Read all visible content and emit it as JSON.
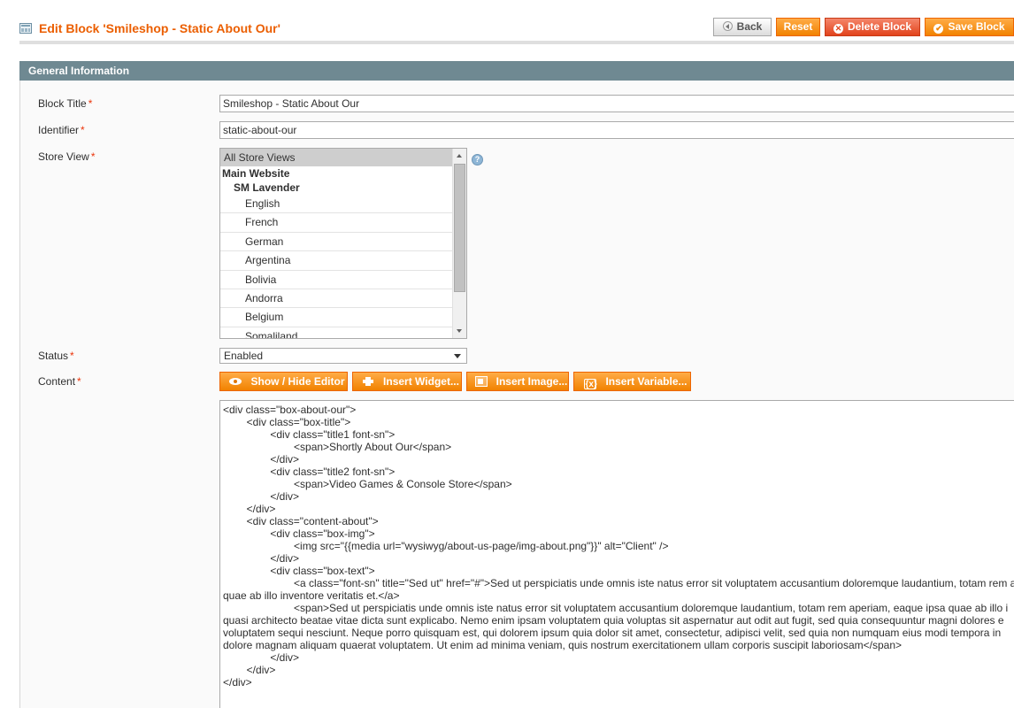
{
  "header": {
    "title": "Edit Block 'Smileshop - Static About Our'",
    "icon": "grid-icon",
    "buttons": {
      "back": "Back",
      "reset": "Reset",
      "delete": "Delete Block",
      "save": "Save Block"
    }
  },
  "fieldset": {
    "legend": "General Information"
  },
  "form": {
    "block_title": {
      "label": "Block Title",
      "required": "*",
      "value": "Smileshop - Static About Our"
    },
    "identifier": {
      "label": "Identifier",
      "required": "*",
      "value": "static-about-our"
    },
    "store_view": {
      "label": "Store View",
      "required": "*",
      "options": {
        "all": "All Store Views",
        "website": "Main Website",
        "store": "SM Lavender",
        "views": [
          "English",
          "French",
          "German",
          "Argentina",
          "Bolivia",
          "Andorra",
          "Belgium",
          "Somaliland"
        ]
      }
    },
    "status": {
      "label": "Status",
      "required": "*",
      "value": "Enabled"
    },
    "content": {
      "label": "Content",
      "required": "*",
      "buttons": {
        "show_hide": "Show / Hide Editor",
        "insert_widget": "Insert Widget...",
        "insert_image": "Insert Image...",
        "insert_variable": "Insert Variable..."
      },
      "value": "<div class=\"box-about-our\">\n        <div class=\"box-title\">\n                <div class=\"title1 font-sn\">\n                        <span>Shortly About Our</span>\n                </div>\n                <div class=\"title2 font-sn\">\n                        <span>Video Games & Console Store</span>\n                </div>\n        </div>\n        <div class=\"content-about\">\n                <div class=\"box-img\">\n                        <img src=\"{{media url=\"wysiwyg/about-us-page/img-about.png\"}}\" alt=\"Client\" />\n                </div>\n                <div class=\"box-text\">\n                        <a class=\"font-sn\" title=\"Sed ut\" href=\"#\">Sed ut perspiciatis unde omnis iste natus error sit voluptatem accusantium doloremque laudantium, totam rem a\nquae ab illo inventore veritatis et.</a>\n                        <span>Sed ut perspiciatis unde omnis iste natus error sit voluptatem accusantium doloremque laudantium, totam rem aperiam, eaque ipsa quae ab illo i\nquasi architecto beatae vitae dicta sunt explicabo. Nemo enim ipsam voluptatem quia voluptas sit aspernatur aut odit aut fugit, sed quia consequuntur magni dolores e\nvoluptatem sequi nesciunt. Neque porro quisquam est, qui dolorem ipsum quia dolor sit amet, consectetur, adipisci velit, sed quia non numquam eius modi tempora in\ndolore magnam aliquam quaerat voluptatem. Ut enim ad minima veniam, quis nostrum exercitationem ullam corporis suscipit laboriosam</span>\n                </div>\n        </div>\n</div>"
    }
  },
  "colors": {
    "title_orange": "#eb5e00",
    "button_orange": "#f18200",
    "delete_red": "#e2431c",
    "fieldset_header": "#6f8992",
    "required_red": "#eb340a"
  }
}
